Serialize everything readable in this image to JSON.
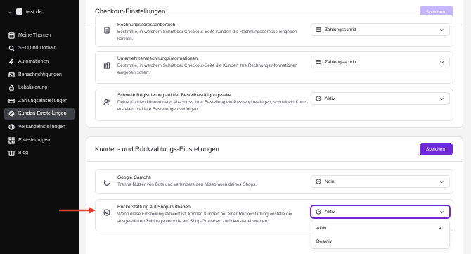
{
  "sidebar": {
    "site_name": "test.de",
    "items": [
      {
        "label": "Meine Themen"
      },
      {
        "label": "SEO und Domain"
      },
      {
        "label": "Automationen"
      },
      {
        "label": "Benachrichtigungen"
      },
      {
        "label": "Lokalisierung"
      },
      {
        "label": "Zahlungseinstellungen"
      },
      {
        "label": "Kunden-Einstellungen",
        "active": true
      },
      {
        "label": "Versandeinstellungen"
      },
      {
        "label": "Erweiterungen"
      },
      {
        "label": "Blog"
      }
    ]
  },
  "checkout": {
    "title": "Checkout-Einstellungen",
    "save_label": "Speichern",
    "rows": [
      {
        "title": "Rechnungsadressenbereich",
        "description": "Bestimme, in welchem Schritt der Checkout-Seite Kunden die Rechnungsadresse eingeben können.",
        "value": "Zahlungsschritt",
        "icon": "receipt-icon"
      },
      {
        "title": "Unternehmensrechnungsinformationen",
        "description": "Bestimme, in welchem Schritt der Checkout-Seite die Kunden ihre Rechnungsinformationen eingeben sollen.",
        "value": "Zahlungsschritt",
        "icon": "building-icon"
      },
      {
        "title": "Schnelle Registrierung auf der Bestellbestätigungsseite",
        "description": "Deine Kunden können nach Abschluss ihrer Bestellung ein Passwort festlegen, schnell ein Konto erstellen und ihre Bestellungen verfolgen.",
        "value": "Aktiv",
        "icon": "user-plus-icon"
      }
    ]
  },
  "refund": {
    "title": "Kunden- und Rückzahlungs-Einstellungen",
    "save_label": "Speichern",
    "rows": [
      {
        "title": "Google Captcha",
        "description": "Trenne Nutzer von Bots und verhindere den Missbrauch deines Shops.",
        "value": "Nein",
        "icon": "refresh-icon"
      },
      {
        "title": "Rückerstattung auf Shop-Guthaben",
        "description": "Wenn diese Einstellung aktiviert ist, können Kunden bei einer Rückerstattung anstelle der ausgewählten Zahlungsmethode auf Shop-Guthaben zurückerstattet werden.",
        "value": "Aktiv",
        "icon": "refund-icon"
      }
    ],
    "dropdown_options": [
      "Aktiv",
      "Deaktiv"
    ],
    "selected_option": "Aktiv"
  },
  "colors": {
    "accent": "#6d28d9",
    "accent_disabled": "#c4b5fd",
    "sidebar_bg": "#0d0d0d",
    "annotation_arrow": "#e53e2e"
  }
}
